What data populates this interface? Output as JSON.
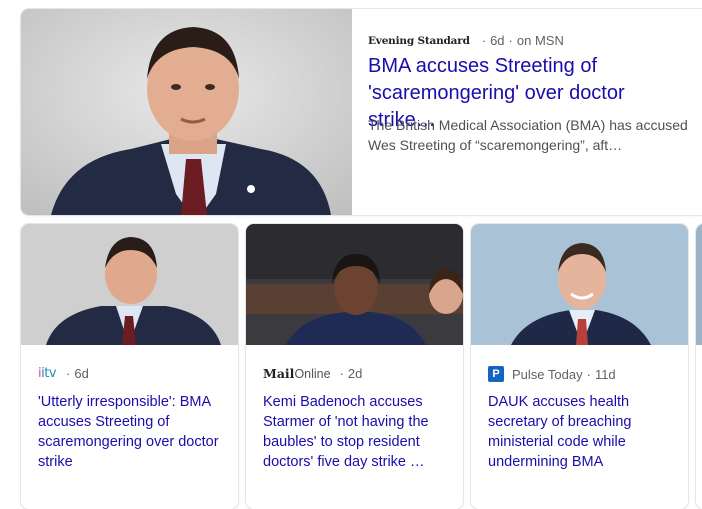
{
  "top_story": {
    "source": "Evening Standard",
    "age": "6d",
    "via": "on MSN",
    "title": "BMA accuses Streeting of 'scaremongering' over doctor strike…",
    "snippet": "The British Medical Association (BMA) has accused Wes Streeting of “scaremongering”, aft…"
  },
  "cards": [
    {
      "source": "itv",
      "age": "6d",
      "title": "'Utterly irresponsible': BMA accuses Streeting of scaremongering over doctor strike"
    },
    {
      "source_bold": "Mail",
      "source_light": "Online",
      "age": "2d",
      "title": "Kemi Badenoch accuses Starmer of 'not having the baubles' to stop resident doctors' five day strike …"
    },
    {
      "source_icon": "P",
      "source": "Pulse Today",
      "age": "11d",
      "title": "DAUK accuses health secretary of breaching ministerial code while undermining BMA"
    }
  ],
  "colors": {
    "link": "#1a0dab",
    "meta": "#5f6368",
    "snippet": "#4d5156"
  }
}
